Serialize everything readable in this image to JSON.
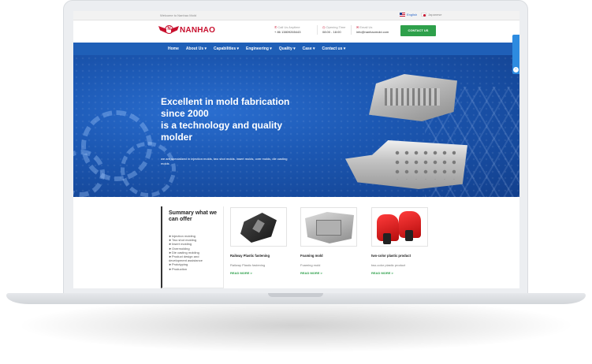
{
  "topbar": {
    "welcome": "Welcome to Nanhao Mold",
    "lang_english": "English",
    "lang_japanese": "Japanese"
  },
  "header": {
    "logo_letter": "N",
    "logo_text": "NANHAO",
    "phone_label": "Call Us Anytime",
    "phone_value": "+ 86 13809265443",
    "time_label": "Opening Time",
    "time_value": "08:00 - 18:00",
    "email_label": "Email Us",
    "email_value": "info@nanhaomold.com",
    "contact_button": "CONTACT US"
  },
  "nav": {
    "items": [
      "Home",
      "About Us ▾",
      "Capabilities ▾",
      "Engineering ▾",
      "Quality ▾",
      "Case ▾",
      "Contact us ▾"
    ]
  },
  "hero": {
    "headline_1": "Excellent in mold fabrication",
    "headline_2": "since 2000",
    "headline_3": "is a technology and quality",
    "headline_4": "molder",
    "subtext": "we are specialized in injection molds, two shot molds, insert molds, over molds, die casting molds"
  },
  "summary": {
    "title_1": "Summary what we",
    "title_2": "can offer",
    "items": [
      "►Injection molding",
      "►Two shot molding",
      "►Insert molding",
      "►Overmolding",
      "►Die casting molding",
      "►Product design and",
      "development assistance",
      "►Prototyping",
      "►Production"
    ]
  },
  "products": [
    {
      "title": "Railway Plastic fastening",
      "desc": "Railway Plastic fastening",
      "more": "READ MORE >"
    },
    {
      "title": "Foaming mold",
      "desc": "Foaming mold",
      "more": "READ MORE >"
    },
    {
      "title": "two-color plastic product",
      "desc": "two-color plastic product",
      "more": "READ MORE >"
    }
  ],
  "side_widget": {
    "arrow": "‹"
  }
}
